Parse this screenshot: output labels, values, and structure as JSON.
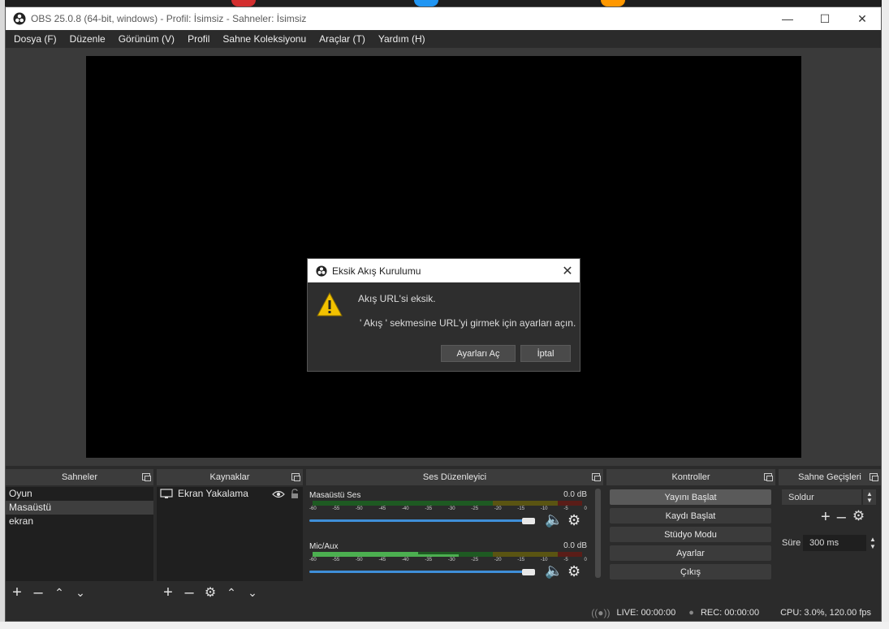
{
  "window": {
    "title": "OBS 25.0.8 (64-bit, windows) - Profil: İsimsiz - Sahneler: İsimsiz"
  },
  "menu": [
    "Dosya (F)",
    "Düzenle",
    "Görünüm (V)",
    "Profil",
    "Sahne Koleksiyonu",
    "Araçlar (T)",
    "Yardım (H)"
  ],
  "dialog": {
    "title": "Eksik Akış Kurulumu",
    "message": "Akış URL'si eksik.",
    "detail": "' Akış ' sekmesine URL'yi girmek için ayarları açın.",
    "open_settings": "Ayarları Aç",
    "cancel": "İptal"
  },
  "scenes": {
    "title": "Sahneler",
    "items": [
      "Oyun",
      "Masaüstü",
      "ekran"
    ],
    "selected": 1
  },
  "sources": {
    "title": "Kaynaklar",
    "items": [
      "Ekran Yakalama"
    ]
  },
  "mixer": {
    "title": "Ses Düzenleyici",
    "ticks": [
      "-60",
      "-55",
      "-50",
      "-45",
      "-40",
      "-35",
      "-30",
      "-25",
      "-20",
      "-15",
      "-10",
      "-5",
      "0"
    ],
    "channels": [
      {
        "name": "Masaüstü Ses",
        "db": "0.0 dB"
      },
      {
        "name": "Mic/Aux",
        "db": "0.0 dB"
      }
    ]
  },
  "controls": {
    "title": "Kontroller",
    "buttons": [
      "Yayını Başlat",
      "Kaydı Başlat",
      "Stüdyo Modu",
      "Ayarlar",
      "Çıkış"
    ]
  },
  "transitions": {
    "title": "Sahne Geçişleri",
    "selected": "Soldur",
    "duration_label": "Süre",
    "duration_value": "300 ms"
  },
  "status": {
    "live": "LIVE: 00:00:00",
    "rec": "REC: 00:00:00",
    "cpu": "CPU: 3.0%, 120.00 fps"
  },
  "colors": {
    "meter_green": "#4caf50",
    "meter_yellow": "#c8b400",
    "meter_red": "#c0392b",
    "slider_blue": "#3f8fd9",
    "warning": "#f2c200"
  }
}
